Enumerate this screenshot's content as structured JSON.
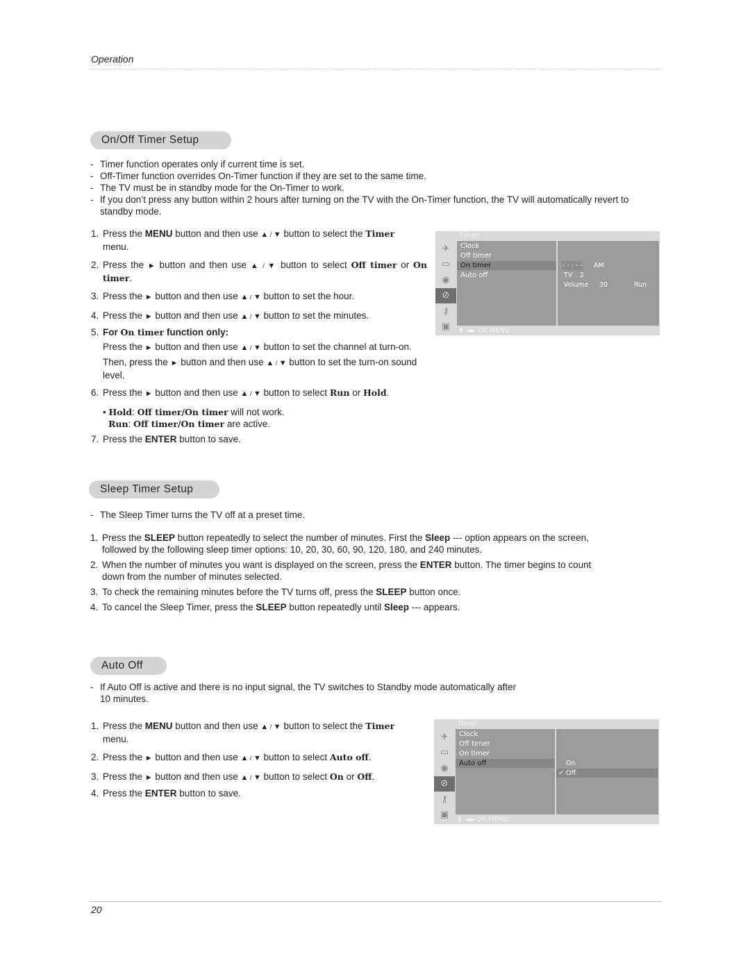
{
  "header": {
    "section": "Operation"
  },
  "footer": {
    "page_number": "20"
  },
  "onoff": {
    "title": "On/Off Timer Setup",
    "notes": [
      "Timer function operates only if current time is set.",
      "Off-Timer function overrides On-Timer function if they are set to the same time.",
      "The TV must be in standby mode for the On-Timer to work.",
      "If you don’t press any button within 2 hours after turning on the TV with the On-Timer function, the TV will automatically revert to standby mode."
    ],
    "steps": {
      "s1": {
        "n": "1.",
        "a": "Press the ",
        "b": "MENU",
        "c": " button and then use ",
        "d": " button to select the ",
        "e": "Timer",
        "f": "menu."
      },
      "s2": {
        "n": "2.",
        "a": "Press the ",
        "c": " button and then use ",
        "d": " button to select ",
        "e": "Off timer",
        "g": " or ",
        "h": "On timer",
        "i": "."
      },
      "s3": {
        "n": "3.",
        "a": "Press the ",
        "c": " button and then use ",
        "d": " button to set the hour."
      },
      "s4": {
        "n": "4.",
        "a": "Press the ",
        "c": " button and then use ",
        "d": " button to set the minutes."
      },
      "s5": {
        "n": "5.",
        "a": "For ",
        "b": "On timer",
        "c": " function only:",
        "p1a": "Press the ",
        "p1b": " button and then use ",
        "p1c": " button to set the channel at turn-on.",
        "p2a": "Then, press the ",
        "p2b": " button and then use ",
        "p2c": " button to set the turn-on sound level."
      },
      "s6": {
        "n": "6.",
        "a": "Press the ",
        "c": " button and then use ",
        "d": " button to select ",
        "e": "Run",
        "g": " or ",
        "h": "Hold",
        "i": ".",
        "hold_a": "Hold",
        "hold_b": "Off timer/On timer",
        "hold_c": " will not work.",
        "run_a": "Run",
        "run_b": "Off timer/On timer",
        "run_c": " are active."
      },
      "s7": {
        "n": "7.",
        "a": "Press the ",
        "b": "ENTER",
        "c": " button to save."
      }
    },
    "osd": {
      "title": "Timer",
      "items": [
        "Clock",
        "Off timer",
        "On timer",
        "Auto off"
      ],
      "selected_item": "On timer",
      "time": "- - : - -",
      "ampm": "AM",
      "source": "TV",
      "channel": "2",
      "volume_label": "Volume",
      "volume": "30",
      "mode": "Run",
      "footer": "OK   MENU"
    }
  },
  "sleep": {
    "title": "Sleep Timer Setup",
    "notes": [
      "The Sleep Timer turns the TV off at a preset time."
    ],
    "steps": {
      "s1": {
        "n": "1.",
        "a": "Press the ",
        "b": "SLEEP",
        "c": " button repeatedly to select the number of minutes. First the  ",
        "d": "Sleep",
        "e": " ---  option appears on the screen, followed by the following sleep timer options: 10, 20, 30, 60, 90, 120, 180, and 240 minutes."
      },
      "s2": {
        "n": "2.",
        "a": "When the number of minutes you want is displayed on the screen, press the ",
        "b": "ENTER",
        "c": " button. The timer begins to count down from the number of minutes selected."
      },
      "s3": {
        "n": "3.",
        "a": "To check the remaining minutes before the TV turns off, press the ",
        "b": "SLEEP",
        "c": " button once."
      },
      "s4": {
        "n": "4.",
        "a": "To cancel the Sleep Timer, press the ",
        "b": "SLEEP",
        "c": " button repeatedly until ",
        "d": "Sleep",
        "e": " --- appears."
      }
    }
  },
  "autooff": {
    "title": "Auto Off",
    "notes": [
      "If Auto Off is active and there is no input signal, the TV switches to Standby mode automatically after 10 minutes."
    ],
    "steps": {
      "s1": {
        "n": "1.",
        "a": "Press the ",
        "b": "MENU",
        "c": " button and then use ",
        "d": " button to select the ",
        "e": "Timer",
        "f": "menu."
      },
      "s2": {
        "n": "2.",
        "a": "Press the ",
        "c": " button and then use ",
        "d": " button to select ",
        "e": "Auto off",
        "i": "."
      },
      "s3": {
        "n": "3.",
        "a": "Press the ",
        "c": " button and then use ",
        "d": " button to select ",
        "e": "On",
        "g": " or ",
        "h": "Off",
        "i": "."
      },
      "s4": {
        "n": "4.",
        "a": "Press the ",
        "b": "ENTER",
        "c": " button to save."
      }
    },
    "osd": {
      "title": "Timer",
      "items": [
        "Clock",
        "Off timer",
        "On timer",
        "Auto off"
      ],
      "selected_item": "Auto off",
      "options": [
        "On",
        "Off"
      ],
      "selected_option": "Off",
      "check": "✓",
      "footer": "OK   MENU"
    }
  },
  "glyphs": {
    "up": "▲",
    "down": "▼",
    "right": "►",
    "slash": " / ",
    "bullet": "•",
    "updown": "⬍",
    "leftright": "◄►"
  }
}
